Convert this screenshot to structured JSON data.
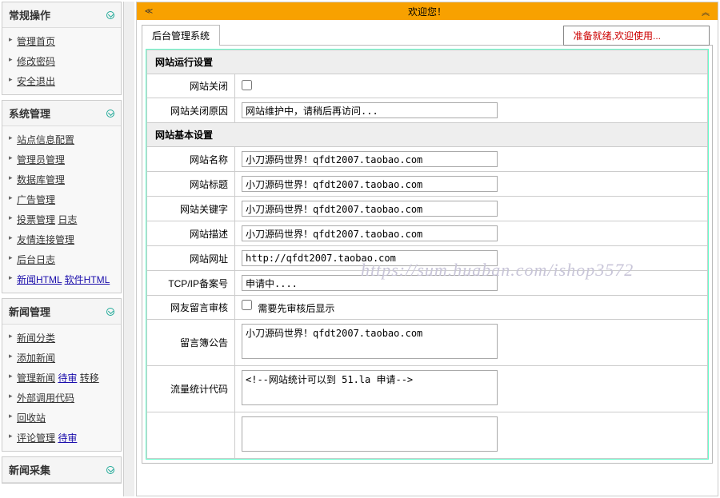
{
  "sidebar": {
    "panels": [
      {
        "title": "常规操作",
        "items": [
          {
            "label": "管理首页"
          },
          {
            "label": "修改密码"
          },
          {
            "label": "安全退出"
          }
        ]
      },
      {
        "title": "系统管理",
        "items": [
          {
            "label": "站点信息配置"
          },
          {
            "label": "管理员管理"
          },
          {
            "label": "数据库管理"
          },
          {
            "label": "广告管理"
          },
          {
            "label": "投票管理",
            "extra": "日志"
          },
          {
            "label": "友情连接管理"
          },
          {
            "label": "后台日志"
          },
          {
            "label": "新闻HTML",
            "blue": true,
            "extra": "软件HTML",
            "extra_blue": true
          }
        ]
      },
      {
        "title": "新闻管理",
        "items": [
          {
            "label": "新闻分类"
          },
          {
            "label": "添加新闻"
          },
          {
            "label": "管理新闻",
            "extra": "待审",
            "extra_blue": true,
            "extra2": "转移"
          },
          {
            "label": "外部调用代码"
          },
          {
            "label": "回收站"
          },
          {
            "label": "评论管理",
            "extra": "待审",
            "extra_blue": true
          }
        ]
      },
      {
        "title": "新闻采集",
        "items": []
      }
    ]
  },
  "titlebar": {
    "center": "欢迎您！"
  },
  "tab": "后台管理系统",
  "status": "准备就绪,欢迎使用...",
  "form": {
    "section1": "网站运行设置",
    "row_close_label": "网站关闭",
    "row_close_reason_label": "网站关闭原因",
    "row_close_reason_value": "网站维护中，请稍后再访问...",
    "section2": "网站基本设置",
    "row_name_label": "网站名称",
    "row_name_value": "小刀源码世界！qfdt2007.taobao.com",
    "row_title_label": "网站标题",
    "row_title_value": "小刀源码世界！qfdt2007.taobao.com",
    "row_keywords_label": "网站关键字",
    "row_keywords_value": "小刀源码世界！qfdt2007.taobao.com",
    "row_desc_label": "网站描述",
    "row_desc_value": "小刀源码世界！qfdt2007.taobao.com",
    "row_url_label": "网站网址",
    "row_url_value": "http://qfdt2007.taobao.com",
    "row_icp_label": "TCP/IP备案号",
    "row_icp_value": "申请中....",
    "row_guest_audit_label": "网友留言审核",
    "row_guest_audit_text": "需要先审核后显示",
    "row_guest_notice_label": "留言簿公告",
    "row_guest_notice_value": "小刀源码世界！qfdt2007.taobao.com",
    "row_stats_label": "流量统计代码",
    "row_stats_value": "<!--网站统计可以到 51.la 申请-->"
  },
  "watermark": "https://sum.huaban.com/ishop3572"
}
